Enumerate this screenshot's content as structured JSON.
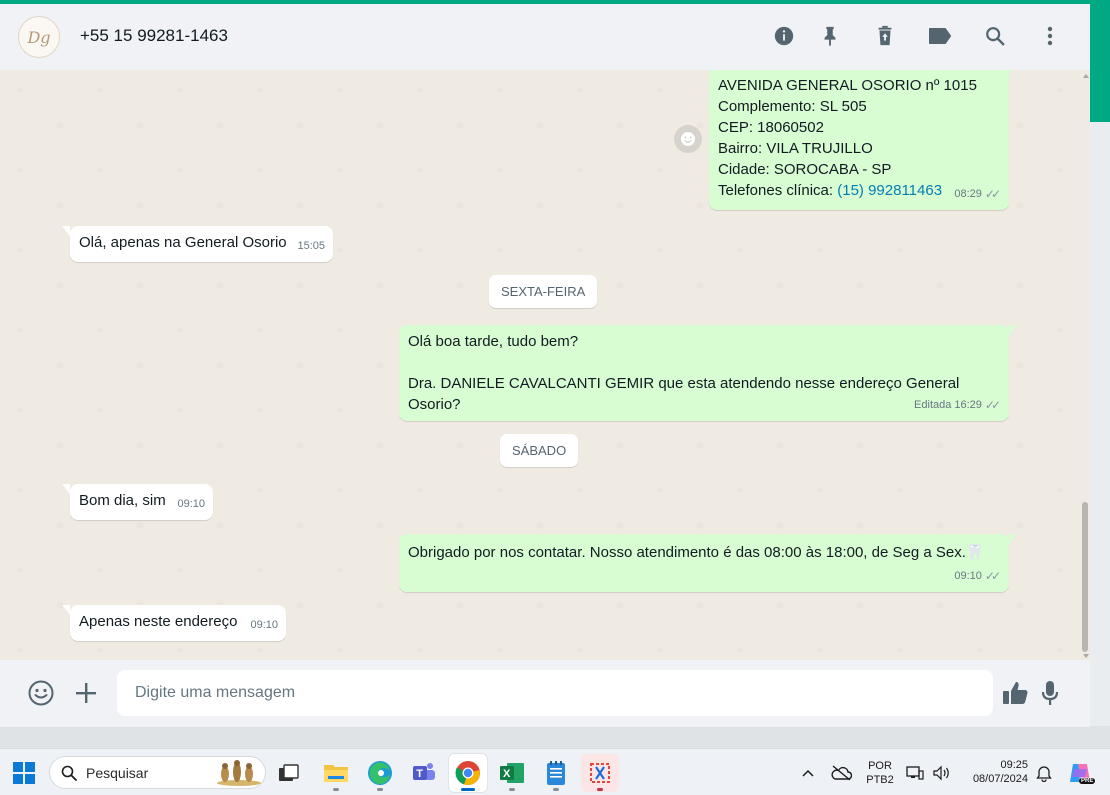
{
  "header": {
    "avatar_text": "Dg",
    "contact_name": "+55 15 99281-1463"
  },
  "messages": [
    {
      "id": "m1",
      "dir": "out",
      "lines": [
        "AVENIDA GENERAL OSORIO nº 1015",
        "Complemento: SL 505",
        "CEP: 18060502",
        "Bairro: VILA TRUJILLO",
        "Cidade: SOROCABA - SP"
      ],
      "phone_prefix": "Telefones clínica: ",
      "phone_link": "(15) 992811463",
      "time": "08:29"
    },
    {
      "id": "m2",
      "dir": "in",
      "text": "Olá, apenas na General Osorio",
      "time": "15:05"
    },
    {
      "id": "m3",
      "dir": "out",
      "line1": "Olá boa tarde, tudo bem?",
      "line2": "Dra. DANIELE CAVALCANTI GEMIR que esta atendendo nesse endereço General",
      "line3": "Osorio?",
      "edited": "Editada",
      "time": "16:29"
    },
    {
      "id": "m4",
      "dir": "in",
      "text": "Bom dia, sim",
      "time": "09:10"
    },
    {
      "id": "m5",
      "dir": "out",
      "text": "Obrigado por nos contatar. Nosso atendimento é das 08:00 às 18:00, de Seg a Sex.",
      "emoji": "🦷",
      "time": "09:10"
    },
    {
      "id": "m6",
      "dir": "in",
      "text": "Apenas neste endereço",
      "time": "09:10"
    }
  ],
  "day_separators": [
    "SEXTA-FEIRA",
    "SÁBADO"
  ],
  "composer": {
    "placeholder": "Digite uma mensagem"
  },
  "taskbar": {
    "search_placeholder": "Pesquisar",
    "lang_top": "POR",
    "lang_bottom": "PTB2",
    "time": "09:25",
    "date": "08/07/2024",
    "badge": "PRE"
  },
  "colors": {
    "accent": "#00a884",
    "outgoing_bubble": "#d9fdd3",
    "incoming_bubble": "#ffffff",
    "chat_bg": "#efeae2",
    "link": "#027eb5"
  }
}
